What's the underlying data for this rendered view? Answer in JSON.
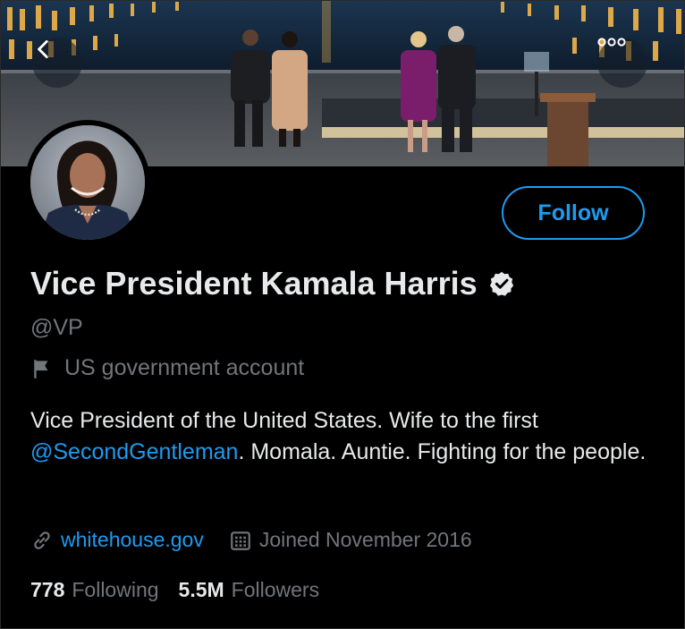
{
  "header": {
    "back_icon": "arrow-left-icon",
    "more_icon": "more-horizontal-icon"
  },
  "profile": {
    "name": "Vice President Kamala Harris",
    "handle": "@VP",
    "label": "US government account",
    "bio_before": "Vice President of the United States. Wife to the first ",
    "bio_mention": "@SecondGentleman",
    "bio_after": ". Momala. Auntie. Fighting for the people.",
    "website": "whitehouse.gov",
    "joined": "Joined November 2016",
    "following_count": "778",
    "following_label": "Following",
    "followers_count": "5.5M",
    "followers_label": "Followers"
  },
  "actions": {
    "follow_label": "Follow"
  },
  "colors": {
    "accent": "#1d9bf0",
    "background": "#000000",
    "muted": "#71767b",
    "text": "#e7e9ea"
  }
}
